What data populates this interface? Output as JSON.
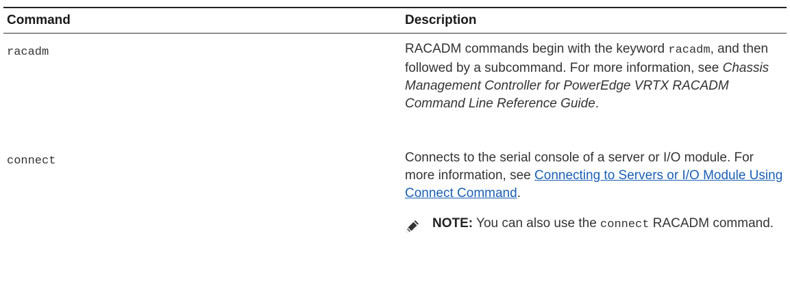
{
  "table": {
    "headers": {
      "command": "Command",
      "description": "Description"
    },
    "rows": [
      {
        "command": "racadm",
        "desc_parts": {
          "p1": "RACADM commands begin with the keyword",
          "code": "racadm",
          "p2": ", and then followed by a subcommand. For more information, see",
          "italic": "Chassis Management Controller for PowerEdge VRTX RACADM Command Line Reference Guide",
          "p3": "."
        }
      },
      {
        "command": "connect",
        "desc_parts": {
          "p1": "Connects to the serial console of a server or I/O module. For more information, see",
          "link": "Connecting to Servers or I/O Module Using Connect Command",
          "p2": "."
        },
        "note": {
          "icon": "note-pencil-icon",
          "label": "NOTE:",
          "p1": "You can also use the",
          "code": "connect",
          "p2": "RACADM command."
        }
      }
    ]
  }
}
